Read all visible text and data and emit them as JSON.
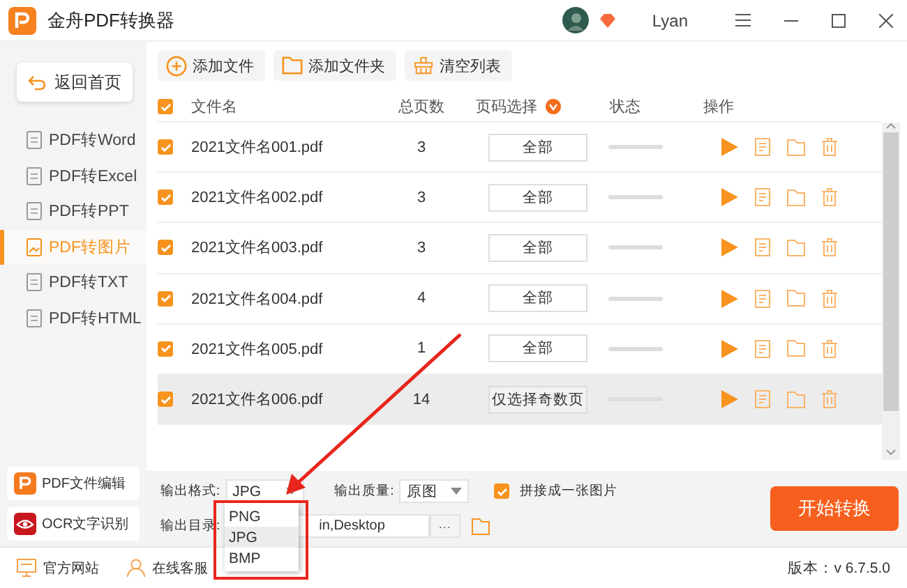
{
  "window": {
    "title": "金舟PDF转换器",
    "user": "Lyan"
  },
  "sidebar": {
    "back_button": "返回首页",
    "items": [
      {
        "label": "PDF转Word",
        "selected": false
      },
      {
        "label": "PDF转Excel",
        "selected": false
      },
      {
        "label": "PDF转PPT",
        "selected": false
      },
      {
        "label": "PDF转图片",
        "selected": true
      },
      {
        "label": "PDF转TXT",
        "selected": false
      },
      {
        "label": "PDF转HTML",
        "selected": false
      }
    ],
    "tools": [
      {
        "kind": "edit",
        "label": "PDF文件编辑"
      },
      {
        "kind": "ocr",
        "label": "OCR文字识别"
      }
    ]
  },
  "toolbar": [
    {
      "kind": "add",
      "label": "添加文件"
    },
    {
      "kind": "folder",
      "label": "添加文件夹"
    },
    {
      "kind": "clear",
      "label": "清空列表"
    }
  ],
  "table": {
    "all_checked": true,
    "columns": [
      "文件名",
      "总页数",
      "页码选择",
      "状态",
      "操作"
    ],
    "rows": [
      {
        "checked": true,
        "selected": false,
        "name": "2021文件名001.pdf",
        "pages": "3",
        "page_range": "全部"
      },
      {
        "checked": true,
        "selected": false,
        "name": "2021文件名002.pdf",
        "pages": "3",
        "page_range": "全部"
      },
      {
        "checked": true,
        "selected": false,
        "name": "2021文件名003.pdf",
        "pages": "3",
        "page_range": "全部"
      },
      {
        "checked": true,
        "selected": false,
        "name": "2021文件名004.pdf",
        "pages": "4",
        "page_range": "全部"
      },
      {
        "checked": true,
        "selected": false,
        "name": "2021文件名005.pdf",
        "pages": "1",
        "page_range": "全部"
      },
      {
        "checked": true,
        "selected": true,
        "name": "2021文件名006.pdf",
        "pages": "14",
        "page_range": "仅选择奇数页"
      }
    ]
  },
  "output": {
    "format_label": "输出格式:",
    "format_value": "JPG",
    "format_options": [
      {
        "label": "PNG",
        "selected": false
      },
      {
        "label": "JPG",
        "selected": true
      },
      {
        "label": "BMP",
        "selected": false
      }
    ],
    "quality_label": "输出质量:",
    "quality_value": "原图",
    "merge": {
      "label": "拼接成一张图片",
      "checked": true
    },
    "directory_label": "输出目录:",
    "directory_value": "in,Desktop",
    "browse": "···",
    "start_button": "开始转换"
  },
  "status_bar": {
    "website": "官方网站",
    "support": "在线客服",
    "version": "版本：v 6.7.5.0"
  }
}
